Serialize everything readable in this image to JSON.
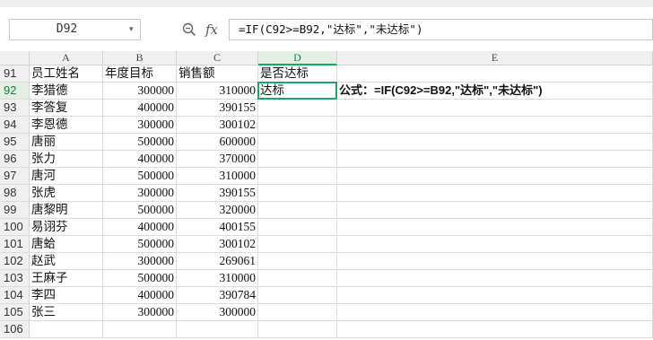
{
  "name_box": {
    "value": "D92"
  },
  "formula_bar": {
    "fx_label": "fx",
    "value": "=IF(C92>=B92,\"达标\",\"未达标\")"
  },
  "columns": [
    "A",
    "B",
    "C",
    "D",
    "E"
  ],
  "selected_cell": "D92",
  "rows": [
    {
      "num": "91",
      "a": "员工姓名",
      "b": "年度目标",
      "c": "销售额",
      "d": "是否达标",
      "e": ""
    },
    {
      "num": "92",
      "a": "李猎德",
      "b": "300000",
      "c": "310000",
      "d": "达标",
      "e": "公式：=IF(C92>=B92,\"达标\",\"未达标\")"
    },
    {
      "num": "93",
      "a": "李答复",
      "b": "400000",
      "c": "390155",
      "d": "",
      "e": ""
    },
    {
      "num": "94",
      "a": "李恩德",
      "b": "300000",
      "c": "300102",
      "d": "",
      "e": ""
    },
    {
      "num": "95",
      "a": "唐丽",
      "b": "500000",
      "c": "600000",
      "d": "",
      "e": ""
    },
    {
      "num": "96",
      "a": "张力",
      "b": "400000",
      "c": "370000",
      "d": "",
      "e": ""
    },
    {
      "num": "97",
      "a": "唐河",
      "b": "500000",
      "c": "310000",
      "d": "",
      "e": ""
    },
    {
      "num": "98",
      "a": "张虎",
      "b": "300000",
      "c": "390155",
      "d": "",
      "e": ""
    },
    {
      "num": "99",
      "a": "唐黎明",
      "b": "500000",
      "c": "320000",
      "d": "",
      "e": ""
    },
    {
      "num": "100",
      "a": "易诩芬",
      "b": "400000",
      "c": "400155",
      "d": "",
      "e": ""
    },
    {
      "num": "101",
      "a": "唐蛤",
      "b": "500000",
      "c": "300102",
      "d": "",
      "e": ""
    },
    {
      "num": "102",
      "a": "赵武",
      "b": "300000",
      "c": "269061",
      "d": "",
      "e": ""
    },
    {
      "num": "103",
      "a": "王麻子",
      "b": "500000",
      "c": "310000",
      "d": "",
      "e": ""
    },
    {
      "num": "104",
      "a": "李四",
      "b": "400000",
      "c": "390784",
      "d": "",
      "e": ""
    },
    {
      "num": "105",
      "a": "张三",
      "b": "300000",
      "c": "300000",
      "d": "",
      "e": ""
    },
    {
      "num": "106",
      "a": "",
      "b": "",
      "c": "",
      "d": "",
      "e": ""
    }
  ],
  "colors": {
    "selection": "#21a366",
    "header_bg": "#f0f0f0",
    "grid": "#dcdcdc"
  }
}
